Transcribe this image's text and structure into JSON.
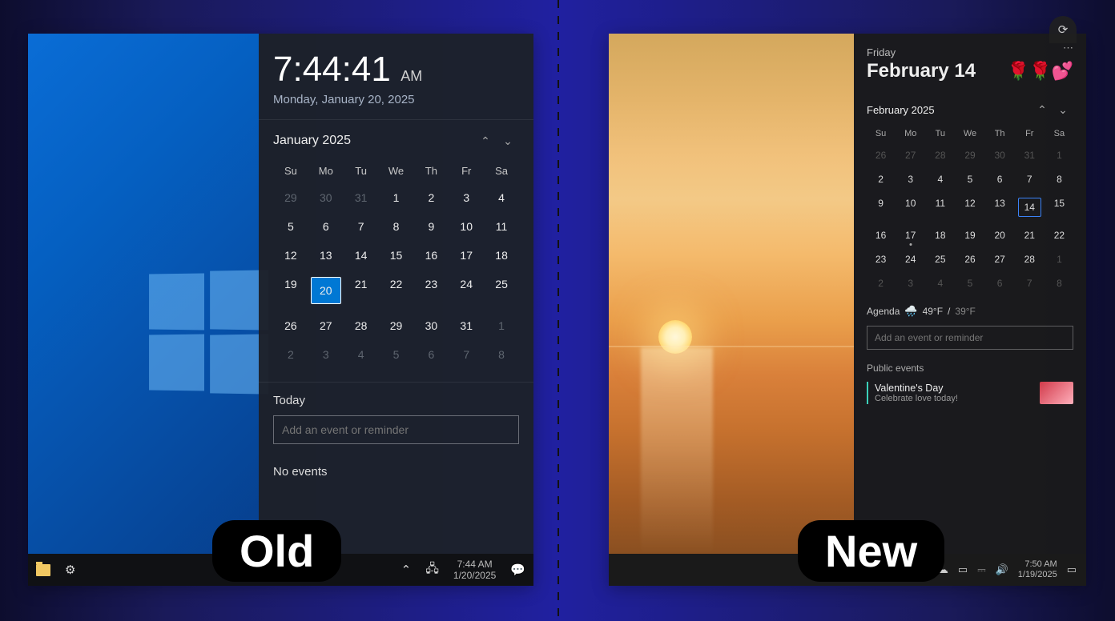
{
  "labels": {
    "old": "Old",
    "new": "New"
  },
  "old": {
    "clock": {
      "time": "7:44:41",
      "ampm": "AM",
      "long_date": "Monday, January 20, 2025"
    },
    "calendar": {
      "month_label": "January 2025",
      "dow": [
        "Su",
        "Mo",
        "Tu",
        "We",
        "Th",
        "Fr",
        "Sa"
      ],
      "days": [
        {
          "n": "29",
          "out": true
        },
        {
          "n": "30",
          "out": true
        },
        {
          "n": "31",
          "out": true
        },
        {
          "n": "1"
        },
        {
          "n": "2"
        },
        {
          "n": "3"
        },
        {
          "n": "4"
        },
        {
          "n": "5"
        },
        {
          "n": "6"
        },
        {
          "n": "7"
        },
        {
          "n": "8"
        },
        {
          "n": "9"
        },
        {
          "n": "10"
        },
        {
          "n": "11"
        },
        {
          "n": "12"
        },
        {
          "n": "13"
        },
        {
          "n": "14"
        },
        {
          "n": "15"
        },
        {
          "n": "16"
        },
        {
          "n": "17"
        },
        {
          "n": "18"
        },
        {
          "n": "19"
        },
        {
          "n": "20",
          "today": true
        },
        {
          "n": "21"
        },
        {
          "n": "22"
        },
        {
          "n": "23"
        },
        {
          "n": "24"
        },
        {
          "n": "25"
        },
        {
          "n": "26"
        },
        {
          "n": "27"
        },
        {
          "n": "28"
        },
        {
          "n": "29"
        },
        {
          "n": "30"
        },
        {
          "n": "31"
        },
        {
          "n": "1",
          "out": true
        },
        {
          "n": "2",
          "out": true
        },
        {
          "n": "3",
          "out": true
        },
        {
          "n": "4",
          "out": true
        },
        {
          "n": "5",
          "out": true
        },
        {
          "n": "6",
          "out": true
        },
        {
          "n": "7",
          "out": true
        },
        {
          "n": "8",
          "out": true
        }
      ]
    },
    "agenda": {
      "today_label": "Today",
      "input_placeholder": "Add an event or reminder",
      "no_events_label": "No events"
    },
    "taskbar": {
      "time": "7:44 AM",
      "date": "1/20/2025"
    }
  },
  "new": {
    "header": {
      "day_name": "Friday",
      "big_date": "February 14",
      "emoji": "🌹🌹💕"
    },
    "calendar": {
      "month_label": "February 2025",
      "dow": [
        "Su",
        "Mo",
        "Tu",
        "We",
        "Th",
        "Fr",
        "Sa"
      ],
      "days": [
        {
          "n": "26",
          "out": true
        },
        {
          "n": "27",
          "out": true
        },
        {
          "n": "28",
          "out": true
        },
        {
          "n": "29",
          "out": true
        },
        {
          "n": "30",
          "out": true
        },
        {
          "n": "31",
          "out": true
        },
        {
          "n": "1",
          "out": true
        },
        {
          "n": "2"
        },
        {
          "n": "3"
        },
        {
          "n": "4"
        },
        {
          "n": "5"
        },
        {
          "n": "6"
        },
        {
          "n": "7"
        },
        {
          "n": "8"
        },
        {
          "n": "9"
        },
        {
          "n": "10"
        },
        {
          "n": "11"
        },
        {
          "n": "12"
        },
        {
          "n": "13"
        },
        {
          "n": "14",
          "sel": true
        },
        {
          "n": "15"
        },
        {
          "n": "16"
        },
        {
          "n": "17",
          "dot": true
        },
        {
          "n": "18"
        },
        {
          "n": "19"
        },
        {
          "n": "20"
        },
        {
          "n": "21"
        },
        {
          "n": "22"
        },
        {
          "n": "23"
        },
        {
          "n": "24"
        },
        {
          "n": "25"
        },
        {
          "n": "26"
        },
        {
          "n": "27"
        },
        {
          "n": "28"
        },
        {
          "n": "1",
          "out": true
        },
        {
          "n": "2",
          "out": true
        },
        {
          "n": "3",
          "out": true
        },
        {
          "n": "4",
          "out": true
        },
        {
          "n": "5",
          "out": true
        },
        {
          "n": "6",
          "out": true
        },
        {
          "n": "7",
          "out": true
        },
        {
          "n": "8",
          "out": true
        }
      ]
    },
    "agenda": {
      "label": "Agenda",
      "weather_icon": "🌧️",
      "temp_hi": "49°F",
      "temp_lo": "39°F",
      "input_placeholder": "Add an event or reminder",
      "public_label": "Public events",
      "event_title": "Valentine's Day",
      "event_sub": "Celebrate love today!"
    },
    "taskbar": {
      "time": "7:50 AM",
      "date": "1/19/2025"
    }
  }
}
